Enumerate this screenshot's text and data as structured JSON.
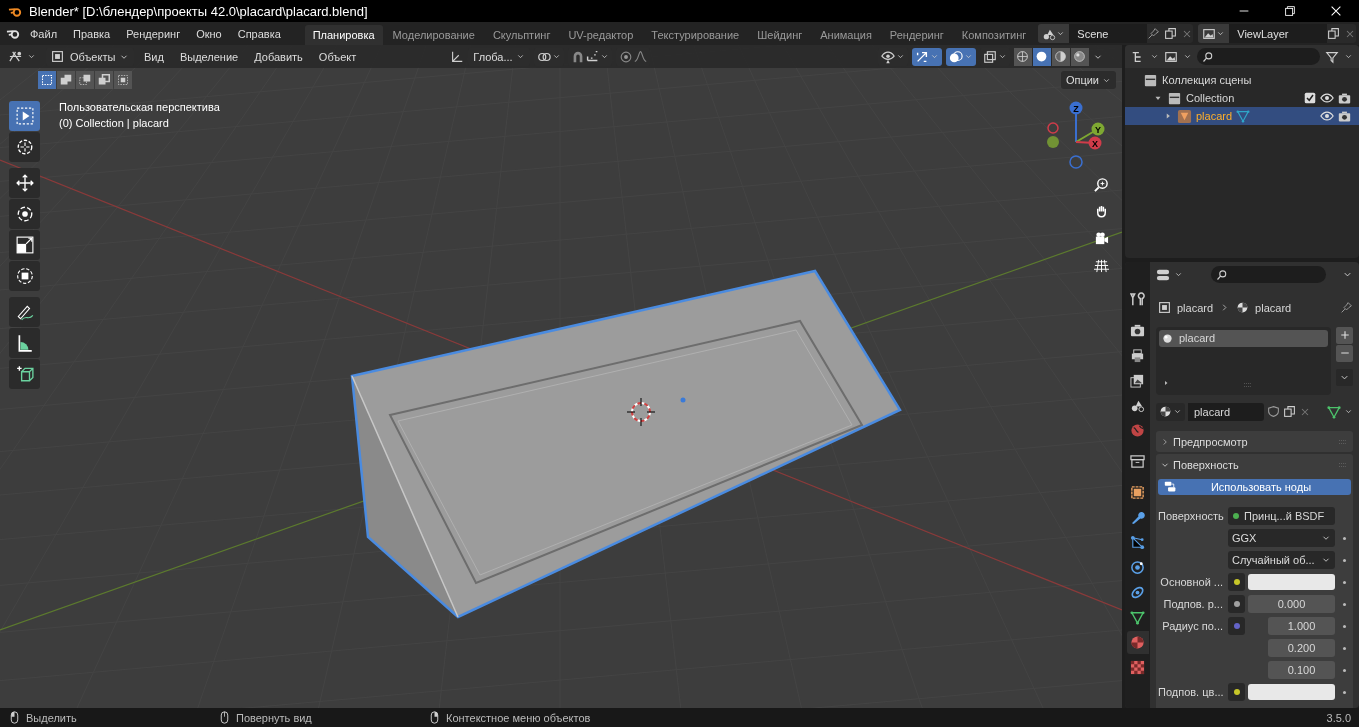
{
  "window": {
    "title": "Blender* [D:\\блендер\\проекты 42.0\\placard\\placard.blend]"
  },
  "menu": [
    "Файл",
    "Правка",
    "Рендеринг",
    "Окно",
    "Справка"
  ],
  "workspaces": [
    {
      "label": "Планировка",
      "selected": true
    },
    {
      "label": "Моделирование",
      "selected": false
    },
    {
      "label": "Скульптинг",
      "selected": false
    },
    {
      "label": "UV-редактор",
      "selected": false
    },
    {
      "label": "Текстурирование",
      "selected": false
    },
    {
      "label": "Шейдинг",
      "selected": false
    },
    {
      "label": "Анимация",
      "selected": false
    },
    {
      "label": "Рендеринг",
      "selected": false
    },
    {
      "label": "Композитинг",
      "selected": false
    }
  ],
  "scene": {
    "name": "Scene"
  },
  "view_layer": {
    "name": "ViewLayer"
  },
  "viewport": {
    "mode": "Объекты",
    "menus": [
      "Вид",
      "Выделение",
      "Добавить",
      "Объект"
    ],
    "orientation": "Глоба...",
    "options": "Опции",
    "overlay_lines": [
      "Пользовательская перспектива",
      "(0) Collection | placard"
    ],
    "select_modes": [
      {
        "selected": true
      },
      {
        "selected": false
      },
      {
        "selected": false
      },
      {
        "selected": false
      },
      {
        "selected": false
      }
    ],
    "toggles": [
      {
        "kind": "snap",
        "on": false
      },
      {
        "kind": "proportional",
        "on": false
      },
      {
        "kind": "visibility",
        "on": false
      },
      {
        "kind": "gizmo",
        "on": true
      },
      {
        "kind": "overlay",
        "on": true
      },
      {
        "kind": "xray",
        "on": false
      }
    ],
    "shading": [
      {
        "selected": false
      },
      {
        "selected": true
      },
      {
        "selected": false
      },
      {
        "selected": false
      }
    ],
    "tools": [
      {
        "kind": "select",
        "selected": true
      },
      {
        "kind": "cursor",
        "selected": false
      },
      {
        "kind": "move",
        "selected": false
      },
      {
        "kind": "rotate",
        "selected": false
      },
      {
        "kind": "scale",
        "selected": false
      },
      {
        "kind": "transform",
        "selected": false
      },
      {
        "kind": "annotate",
        "selected": false
      },
      {
        "kind": "measure",
        "selected": false
      },
      {
        "kind": "add-cube",
        "selected": false
      }
    ],
    "axes": [
      "Z",
      "Y",
      "X"
    ]
  },
  "outliner": {
    "tree": [
      {
        "label": "Коллекция сцены",
        "children": [
          {
            "label": "Collection",
            "expanded": true,
            "checked": true,
            "selected": false,
            "children": [
              {
                "label": "placard",
                "expanded": false,
                "selected": true
              }
            ]
          }
        ]
      }
    ]
  },
  "properties": {
    "tabs": [
      {
        "kind": "tool",
        "selected": false
      },
      {
        "kind": "render",
        "selected": false
      },
      {
        "kind": "output",
        "selected": false
      },
      {
        "kind": "view-layer",
        "selected": false
      },
      {
        "kind": "scene",
        "selected": false
      },
      {
        "kind": "world",
        "selected": false
      },
      {
        "kind": "collection",
        "selected": false
      },
      {
        "kind": "object",
        "selected": false
      },
      {
        "kind": "modifier",
        "selected": false
      },
      {
        "kind": "particles",
        "selected": false
      },
      {
        "kind": "physics",
        "selected": false
      },
      {
        "kind": "constraints",
        "selected": false
      },
      {
        "kind": "data",
        "selected": false
      },
      {
        "kind": "material",
        "selected": true
      },
      {
        "kind": "texture",
        "selected": false
      }
    ],
    "breadcrumb": [
      "placard",
      "placard"
    ],
    "slots": [
      {
        "label": "placard",
        "selected": true
      }
    ],
    "material": "placard",
    "panels": [
      {
        "label": "Предпросмотр",
        "expanded": false
      },
      {
        "label": "Поверхность",
        "expanded": true
      }
    ],
    "use_nodes": "Использовать ноды",
    "fields": [
      {
        "kind": "link",
        "label": "Поверхность",
        "value": "Принц...й BSDF",
        "color": "#4cb050"
      },
      {
        "kind": "dropdown",
        "value": "GGX"
      },
      {
        "kind": "dropdown",
        "value": "Случайный об..."
      },
      {
        "kind": "color",
        "label": "Основной ...",
        "color": "#c7c729"
      },
      {
        "kind": "number",
        "label": "Подпов. р...",
        "color": "#a1a1a1",
        "values": [
          "0.000"
        ]
      },
      {
        "kind": "number",
        "label": "Радиус по...",
        "color": "#6363c7",
        "values": [
          "1.000",
          "0.200",
          "0.100"
        ]
      },
      {
        "kind": "color",
        "label": "Подпов. цв...",
        "color": "#c7c729"
      }
    ]
  },
  "status": [
    {
      "text": "Выделить"
    },
    {
      "text": "Повернуть вид"
    },
    {
      "text": "Контекстное меню объектов"
    }
  ],
  "version": "3.5.0"
}
